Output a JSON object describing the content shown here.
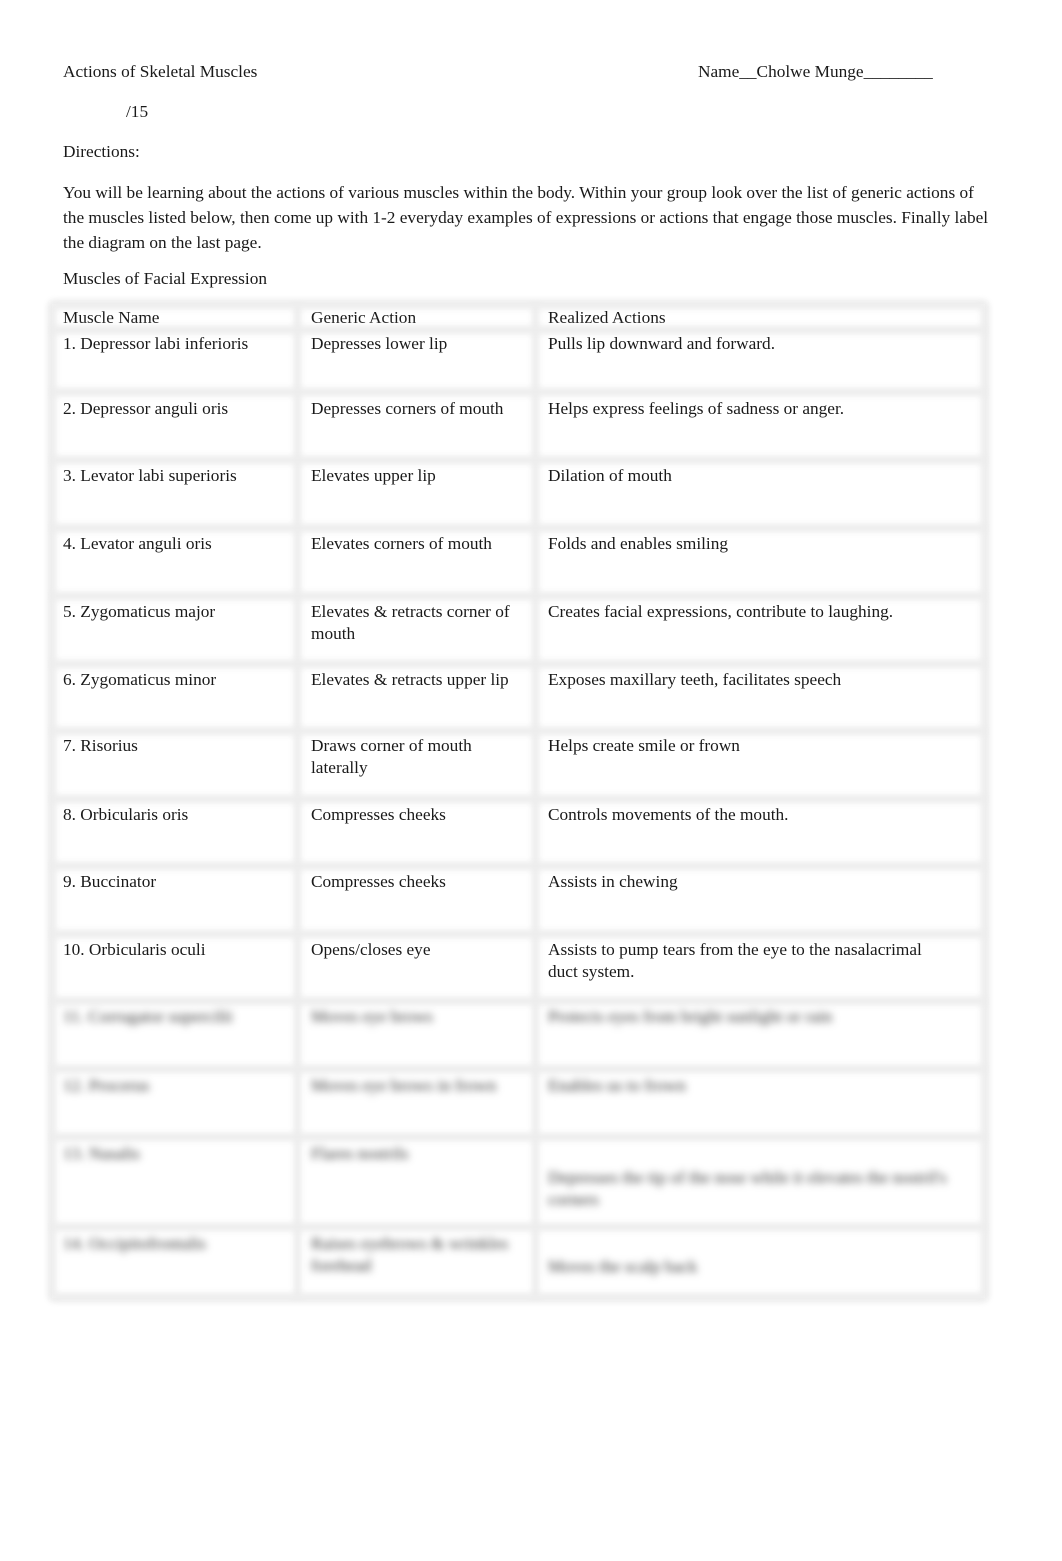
{
  "document": {
    "title": "Actions of Skeletal Muscles",
    "name_line": "Name__Cholwe Munge________",
    "score": "/15",
    "directions_label": "Directions:",
    "directions_text": "You will be learning about the actions of various muscles within the body. Within your group look over the list of generic actions of the muscles listed below, then come up with 1-2 everyday examples of expressions or actions that engage those muscles. Finally label the diagram on the last page.",
    "section_title": "Muscles of Facial Expression"
  },
  "table": {
    "headers": [
      "Muscle Name",
      "Generic Action",
      "Realized Actions"
    ],
    "rows": [
      {
        "muscle": "1. Depressor labi inferioris",
        "generic": "Depresses lower lip",
        "realized": "Pulls lip downward and forward.",
        "blurred": false
      },
      {
        "muscle": "2. Depressor anguli oris",
        "generic": "Depresses corners of mouth",
        "realized": "Helps express feelings of sadness or anger.",
        "blurred": false
      },
      {
        "muscle": "3. Levator labi superioris",
        "generic": "Elevates upper lip",
        "realized": "Dilation of mouth",
        "blurred": false
      },
      {
        "muscle": "4. Levator anguli oris",
        "generic": "Elevates corners of mouth",
        "realized": "Folds and enables smiling",
        "blurred": false
      },
      {
        "muscle": "5. Zygomaticus major",
        "generic": "Elevates & retracts corner of mouth",
        "realized": "Creates facial expressions, contribute to laughing.",
        "blurred": false
      },
      {
        "muscle": "6. Zygomaticus minor",
        "generic": "Elevates & retracts upper lip",
        "realized": "Exposes maxillary teeth, facilitates speech",
        "blurred": false
      },
      {
        "muscle": "7. Risorius",
        "generic": "Draws corner of mouth laterally",
        "realized": "Helps create smile or frown",
        "blurred": false
      },
      {
        "muscle": "8. Orbicularis oris",
        "generic": "Compresses cheeks",
        "realized": "Controls movements of the mouth.",
        "blurred": false
      },
      {
        "muscle": "9. Buccinator",
        "generic": "Compresses cheeks",
        "realized": "Assists in chewing",
        "blurred": false
      },
      {
        "muscle": "10. Orbicularis oculi",
        "generic": "Opens/closes eye",
        "realized": "Assists to pump tears from the eye to the nasalacrimal duct system.",
        "blurred": false
      },
      {
        "muscle": "11. Corrugator supercilii",
        "generic": "Moves eye brows",
        "realized": "Protects eyes from bright sunlight or rain",
        "blurred": true
      },
      {
        "muscle": "12. Procerus",
        "generic": "Moves eye brows in frown",
        "realized": "Enables us to frown",
        "blurred": true
      },
      {
        "muscle": "13. Nasalis",
        "generic": "Flares nostrils",
        "realized": "Depresses the tip of the nose while it elevates the nostril's corners",
        "blurred": true
      },
      {
        "muscle": "14. Occipitofrontalis",
        "generic": "Raises eyebrows & wrinkles forehead",
        "realized": "Moves the scalp back",
        "blurred": true
      }
    ]
  }
}
